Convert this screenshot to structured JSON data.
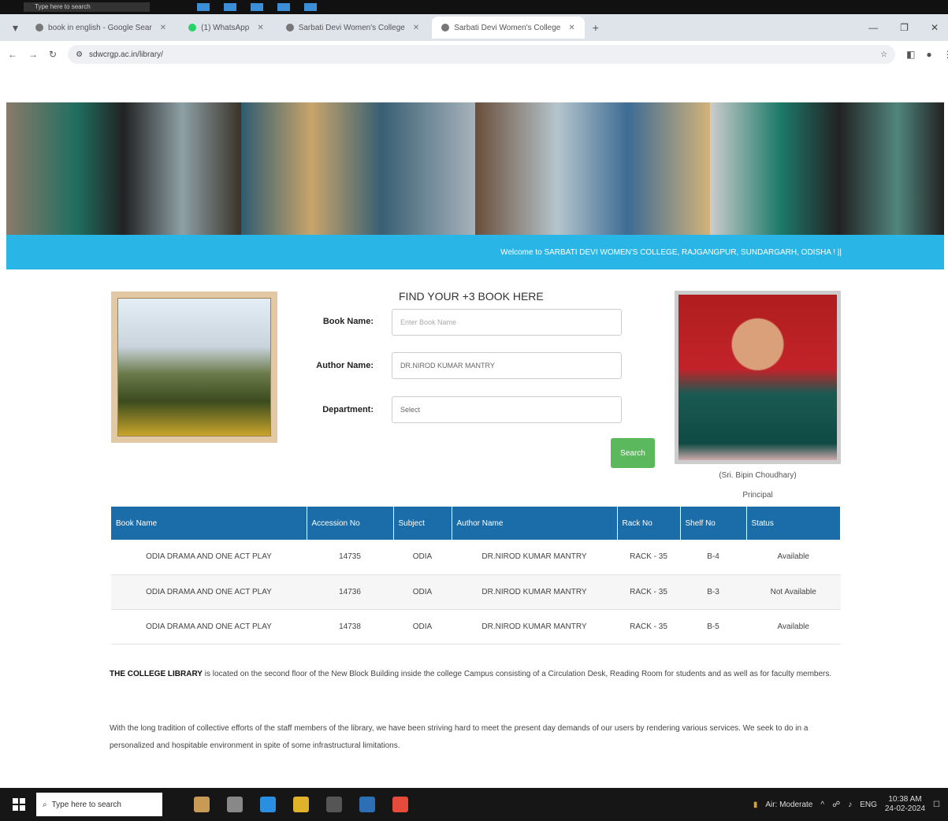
{
  "top_strip": {
    "search_placeholder": "Type here to search"
  },
  "browser": {
    "tabs": [
      {
        "label": "book in english - Google Sear",
        "active": false
      },
      {
        "label": "(1) WhatsApp",
        "active": false
      },
      {
        "label": "Sarbati Devi Women's College",
        "active": false
      },
      {
        "label": "Sarbati Devi Women's College",
        "active": true
      }
    ],
    "url": "sdwcrgp.ac.in/library/"
  },
  "welcome_text": "Welcome to SARBATI DEVI WOMEN'S COLLEGE, RAJGANGPUR, SUNDARGARH, ODISHA ! ||",
  "search_form": {
    "title": "FIND YOUR +3 BOOK HERE",
    "book_name_label": "Book Name:",
    "book_name_placeholder": "Enter Book Name",
    "author_name_label": "Author Name:",
    "author_name_value": "DR.NIROD KUMAR MANTRY",
    "department_label": "Department:",
    "department_value": "Select",
    "search_label": "Search"
  },
  "principal": {
    "name": "(Sri. Bipin Choudhary)",
    "role": "Principal"
  },
  "table": {
    "headers": [
      "Book Name",
      "Accession No",
      "Subject",
      "Author Name",
      "Rack No",
      "Shelf No",
      "Status"
    ],
    "rows": [
      [
        "ODIA DRAMA AND ONE ACT PLAY",
        "14735",
        "ODIA",
        "DR.NIROD KUMAR MANTRY",
        "RACK - 35",
        "B-4",
        "Available"
      ],
      [
        "ODIA DRAMA AND ONE ACT PLAY",
        "14736",
        "ODIA",
        "DR.NIROD KUMAR MANTRY",
        "RACK - 35",
        "B-3",
        "Not Available"
      ],
      [
        "ODIA DRAMA AND ONE ACT PLAY",
        "14738",
        "ODIA",
        "DR.NIROD KUMAR MANTRY",
        "RACK - 35",
        "B-5",
        "Available"
      ]
    ]
  },
  "about": {
    "heading": "THE COLLEGE LIBRARY",
    "para1": "is located on the second floor of the New Block Building inside the college Campus consisting of a Circulation Desk, Reading Room for students and as well as for faculty members.",
    "para2": "With the long tradition of collective efforts of the staff members of the library, we have been striving hard to meet the present day demands of our users by rendering various services. We seek to do in a personalized and hospitable environment in spite of some infrastructural limitations."
  },
  "taskbar": {
    "search_placeholder": "Type here to search",
    "weather": "Air: Moderate",
    "lang": "ENG",
    "time": "10:38 AM",
    "date": "24-02-2024"
  }
}
